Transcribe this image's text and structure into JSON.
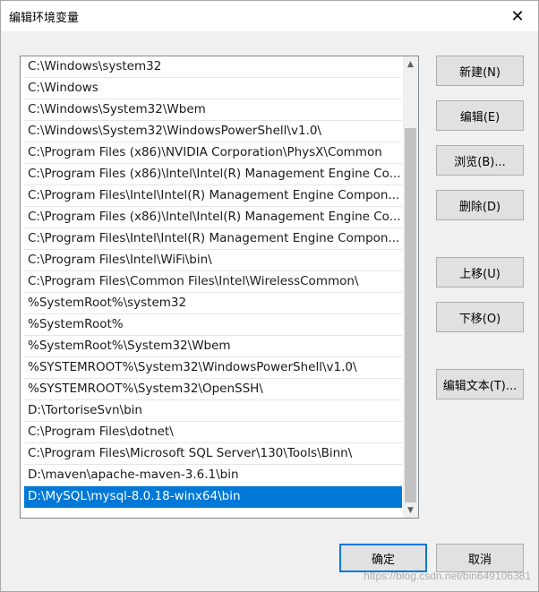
{
  "window": {
    "title": "编辑环境变量",
    "close_symbol": "✕"
  },
  "path_list": {
    "items": [
      "C:\\Windows\\system32",
      "C:\\Windows",
      "C:\\Windows\\System32\\Wbem",
      "C:\\Windows\\System32\\WindowsPowerShell\\v1.0\\",
      "C:\\Program Files (x86)\\NVIDIA Corporation\\PhysX\\Common",
      "C:\\Program Files (x86)\\Intel\\Intel(R) Management Engine Co...",
      "C:\\Program Files\\Intel\\Intel(R) Management Engine Compon...",
      "C:\\Program Files (x86)\\Intel\\Intel(R) Management Engine Co...",
      "C:\\Program Files\\Intel\\Intel(R) Management Engine Compon...",
      "C:\\Program Files\\Intel\\WiFi\\bin\\",
      "C:\\Program Files\\Common Files\\Intel\\WirelessCommon\\",
      "%SystemRoot%\\system32",
      "%SystemRoot%",
      "%SystemRoot%\\System32\\Wbem",
      "%SYSTEMROOT%\\System32\\WindowsPowerShell\\v1.0\\",
      "%SYSTEMROOT%\\System32\\OpenSSH\\",
      "D:\\TortoriseSvn\\bin",
      "C:\\Program Files\\dotnet\\",
      "C:\\Program Files\\Microsoft SQL Server\\130\\Tools\\Binn\\",
      "D:\\maven\\apache-maven-3.6.1\\bin",
      "D:\\MySQL\\mysql-8.0.18-winx64\\bin"
    ],
    "selected_index": 20,
    "scroll_up_symbol": "▲",
    "scroll_down_symbol": "▼"
  },
  "buttons": {
    "new": "新建(N)",
    "edit": "编辑(E)",
    "browse": "浏览(B)...",
    "delete": "删除(D)",
    "move_up": "上移(U)",
    "move_down": "下移(O)",
    "edit_text": "编辑文本(T)...",
    "ok": "确定",
    "cancel": "取消"
  },
  "watermark": "https://blog.csdn.net/bin649106381",
  "colors": {
    "selection": "#0078d7",
    "default_button_border": "#0078d7"
  }
}
